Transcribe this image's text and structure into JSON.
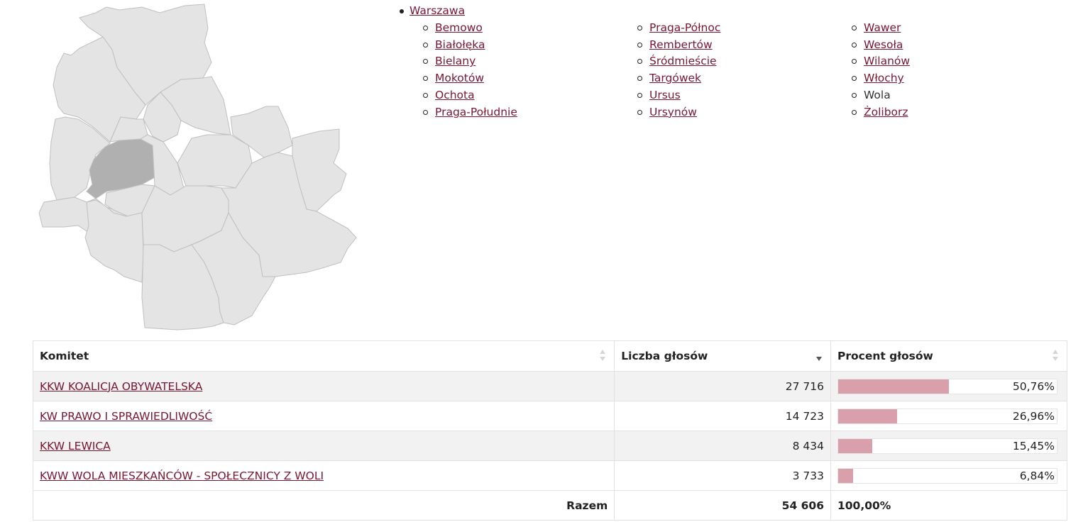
{
  "map": {
    "districts": [
      "Bielany",
      "Białołęka",
      "Targówek",
      "Praga-Północ",
      "Rembertów",
      "Wesoła",
      "Bemowo",
      "Wola",
      "Żoliborz",
      "Śródmieście",
      "Praga-Południe",
      "Włochy",
      "Ochota",
      "Ursus",
      "Mokotów",
      "Wawer",
      "Ursynów",
      "Wilanów"
    ],
    "highlighted": "Wola",
    "fill_color": "#e4e4e4",
    "highlight_color": "#b0b0b0",
    "border_color": "#bfbfbf"
  },
  "nav": {
    "root": "Warszawa",
    "columns": [
      [
        {
          "label": "Bemowo",
          "link": true
        },
        {
          "label": "Białołęka",
          "link": true
        },
        {
          "label": "Bielany",
          "link": true
        },
        {
          "label": "Mokotów",
          "link": true
        },
        {
          "label": "Ochota",
          "link": true
        },
        {
          "label": "Praga-Południe",
          "link": true
        }
      ],
      [
        {
          "label": "Praga-Północ",
          "link": true
        },
        {
          "label": "Rembertów",
          "link": true
        },
        {
          "label": "Śródmieście",
          "link": true
        },
        {
          "label": "Targówek",
          "link": true
        },
        {
          "label": "Ursus",
          "link": true
        },
        {
          "label": "Ursynów",
          "link": true
        }
      ],
      [
        {
          "label": "Wawer",
          "link": true
        },
        {
          "label": "Wesoła",
          "link": true
        },
        {
          "label": "Wilanów",
          "link": true
        },
        {
          "label": "Włochy",
          "link": true
        },
        {
          "label": "Wola",
          "link": false
        },
        {
          "label": "Żoliborz",
          "link": true
        }
      ]
    ]
  },
  "table": {
    "headers": {
      "committee": "Komitet",
      "votes": "Liczba głosów",
      "percent": "Procent głosów"
    },
    "sorted_column": "votes",
    "rows": [
      {
        "name": "KKW KOALICJA OBYWATELSKA",
        "votes": "27 716",
        "percent": "50,76%",
        "share": 0.5076
      },
      {
        "name": "KW PRAWO I SPRAWIEDLIWOŚĆ",
        "votes": "14 723",
        "percent": "26,96%",
        "share": 0.2696
      },
      {
        "name": "KKW LEWICA",
        "votes": "8 434",
        "percent": "15,45%",
        "share": 0.1545
      },
      {
        "name": "KWW WOLA MIESZKAŃCÓW - SPOŁECZNICY Z WOLI",
        "votes": "3 733",
        "percent": "6,84%",
        "share": 0.0684
      }
    ],
    "total": {
      "label": "Razem",
      "votes": "54 606",
      "percent": "100,00%"
    },
    "bar_color": "#d9a0ac",
    "link_color": "#7a1632"
  }
}
